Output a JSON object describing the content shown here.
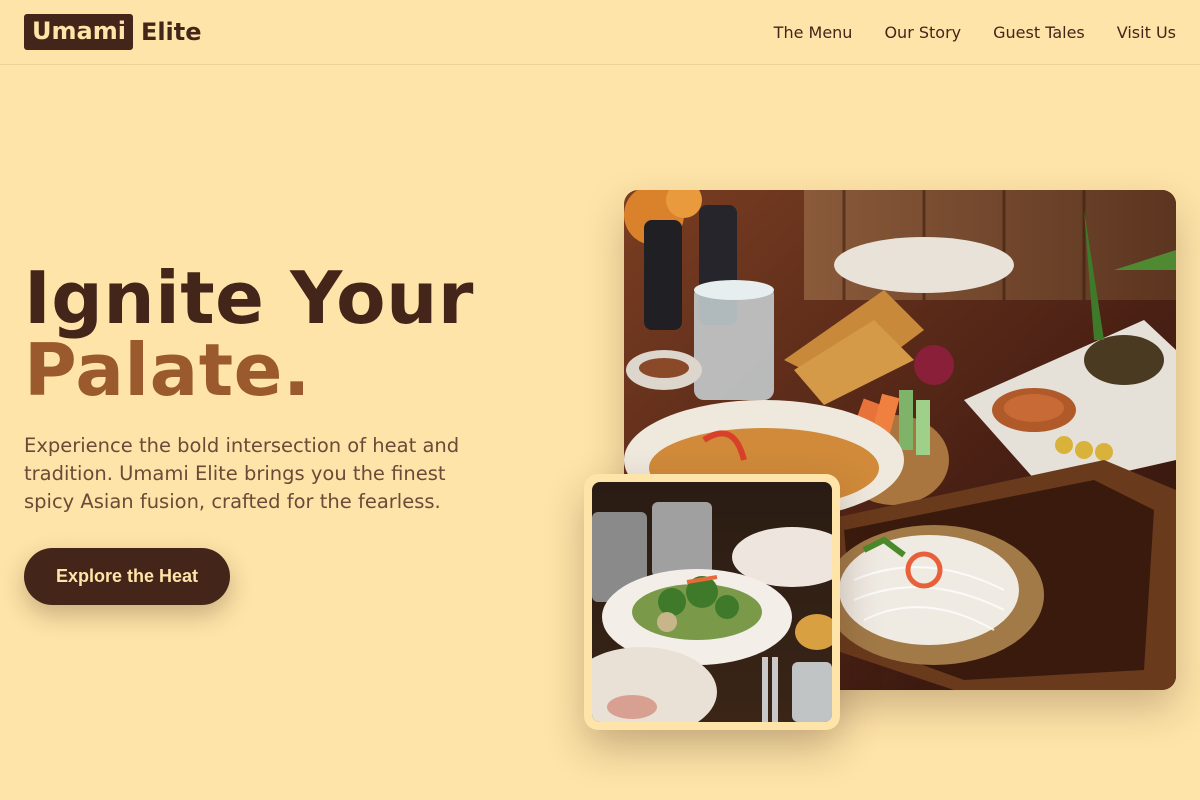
{
  "brand": {
    "box_text": "Umami",
    "text": "Elite"
  },
  "nav": {
    "items": [
      {
        "label": "The Menu"
      },
      {
        "label": "Our Story"
      },
      {
        "label": "Guest Tales"
      },
      {
        "label": "Visit Us"
      }
    ]
  },
  "hero": {
    "title_line1": "Ignite Your",
    "title_line2": "Palate.",
    "description": "Experience the bold intersection of heat and tradition. Umami Elite brings you the finest spicy Asian fusion, crafted for the fearless.",
    "cta_label": "Explore the Heat"
  },
  "colors": {
    "background": "#fee4a8",
    "primary_dark": "#43251a",
    "accent_brown": "#9a5a2e",
    "body_text": "#6a4b38"
  },
  "images": {
    "main": "table-spread-photo",
    "inset": "salad-plate-photo"
  }
}
